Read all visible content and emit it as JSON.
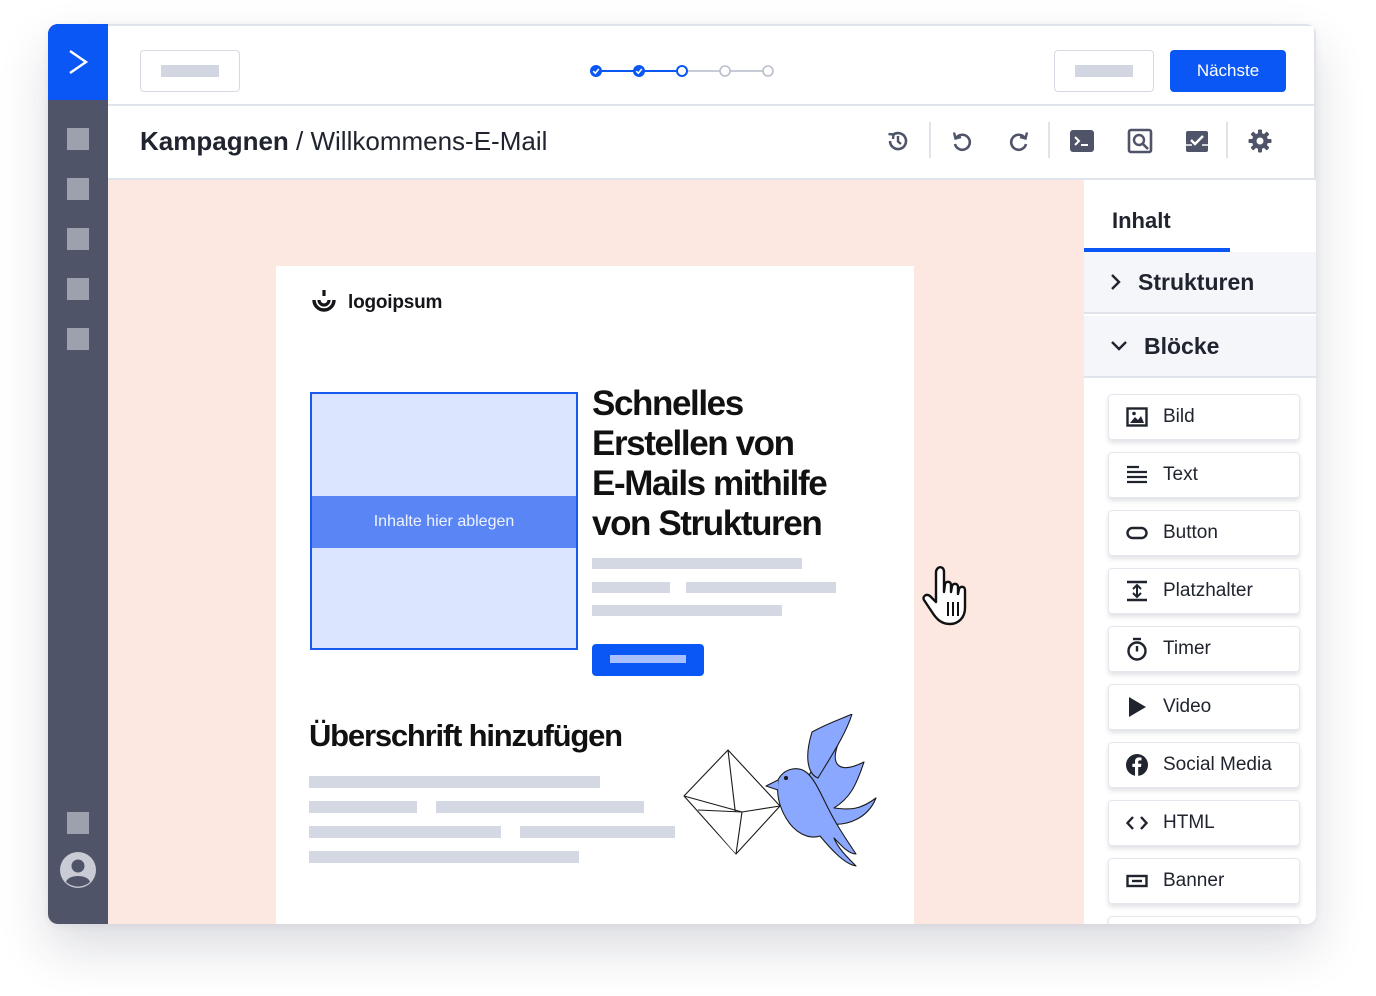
{
  "topbar": {
    "next_label": "Nächste",
    "stepper": {
      "total_steps": 5,
      "completed_steps": 2,
      "current_step": 3
    }
  },
  "breadcrumb": {
    "section": "Kampagnen",
    "separator": " / ",
    "page": "Willkommens-E-Mail"
  },
  "toolbar": {
    "icons": [
      "history-icon",
      "undo-icon",
      "redo-icon",
      "code-icon",
      "preview-icon",
      "test-icon",
      "settings-icon"
    ]
  },
  "email": {
    "brand_name": "logoipsum",
    "drop_label": "Inhalte hier ablegen",
    "hero_lines": [
      "Schnelles",
      "Erstellen von",
      "E-Mails mithilfe",
      "von Strukturen"
    ],
    "heading2": "Überschrift hinzufügen"
  },
  "panel": {
    "tab_label": "Inhalt",
    "sections": [
      {
        "label": "Strukturen",
        "expanded": false
      },
      {
        "label": "Blöcke",
        "expanded": true
      }
    ],
    "blocks": [
      {
        "label": "Bild",
        "icon": "image-icon"
      },
      {
        "label": "Text",
        "icon": "text-icon"
      },
      {
        "label": "Button",
        "icon": "button-icon"
      },
      {
        "label": "Platzhalter",
        "icon": "spacer-icon"
      },
      {
        "label": "Timer",
        "icon": "timer-icon"
      },
      {
        "label": "Video",
        "icon": "video-icon"
      },
      {
        "label": "Social Media",
        "icon": "facebook-icon"
      },
      {
        "label": "HTML",
        "icon": "code-icon"
      },
      {
        "label": "Banner",
        "icon": "banner-icon"
      }
    ]
  },
  "colors": {
    "accent": "#0a57f5",
    "sidebar": "#4f5468",
    "canvas": "#fde8e1",
    "dropzone": "#dbe5ff"
  }
}
